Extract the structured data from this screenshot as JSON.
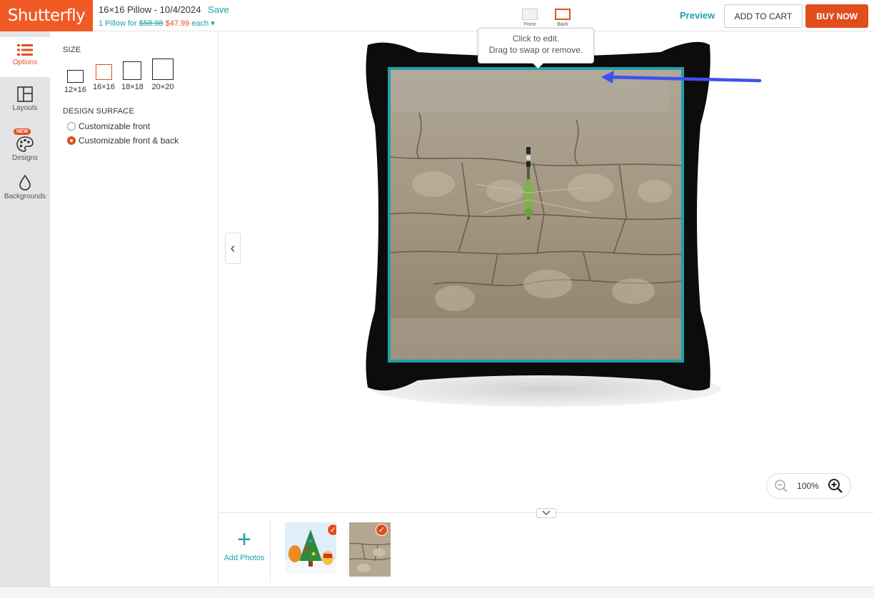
{
  "header": {
    "logo": "Shutterfly",
    "project_title": "16×16 Pillow - 10/4/2024",
    "save_label": "Save",
    "price_qty": "1 Pillow for",
    "price_old": "$58.98",
    "price_new": "$47.99",
    "price_each": "each",
    "front_label": "Front",
    "back_label": "Back",
    "preview_label": "Preview",
    "add_to_cart_label": "ADD TO CART",
    "buy_now_label": "BUY NOW"
  },
  "rail": {
    "items": [
      {
        "label": "Options",
        "icon": "list-icon",
        "active": true
      },
      {
        "label": "Layouts",
        "icon": "layout-icon"
      },
      {
        "label": "Designs",
        "icon": "palette-icon",
        "badge": "NEW"
      },
      {
        "label": "Backgrounds",
        "icon": "drop-icon"
      }
    ]
  },
  "options": {
    "size_heading": "SIZE",
    "sizes": [
      {
        "label": "12×16"
      },
      {
        "label": "16×16",
        "selected": true
      },
      {
        "label": "18×18"
      },
      {
        "label": "20×20"
      }
    ],
    "surface_heading": "DESIGN SURFACE",
    "surfaces": [
      {
        "label": "Customizable front",
        "checked": false
      },
      {
        "label": "Customizable front & back",
        "checked": true
      }
    ]
  },
  "canvas": {
    "tooltip_line1": "Click to edit.",
    "tooltip_line2": "Drag to swap or remove.",
    "zoom_level": "100%"
  },
  "tray": {
    "add_photos_label": "Add Photos"
  },
  "colors": {
    "brand_orange": "#f15a24",
    "accent_teal": "#1fa0a8",
    "buy_red": "#e04e1e",
    "arrow_blue": "#3f51f0"
  }
}
